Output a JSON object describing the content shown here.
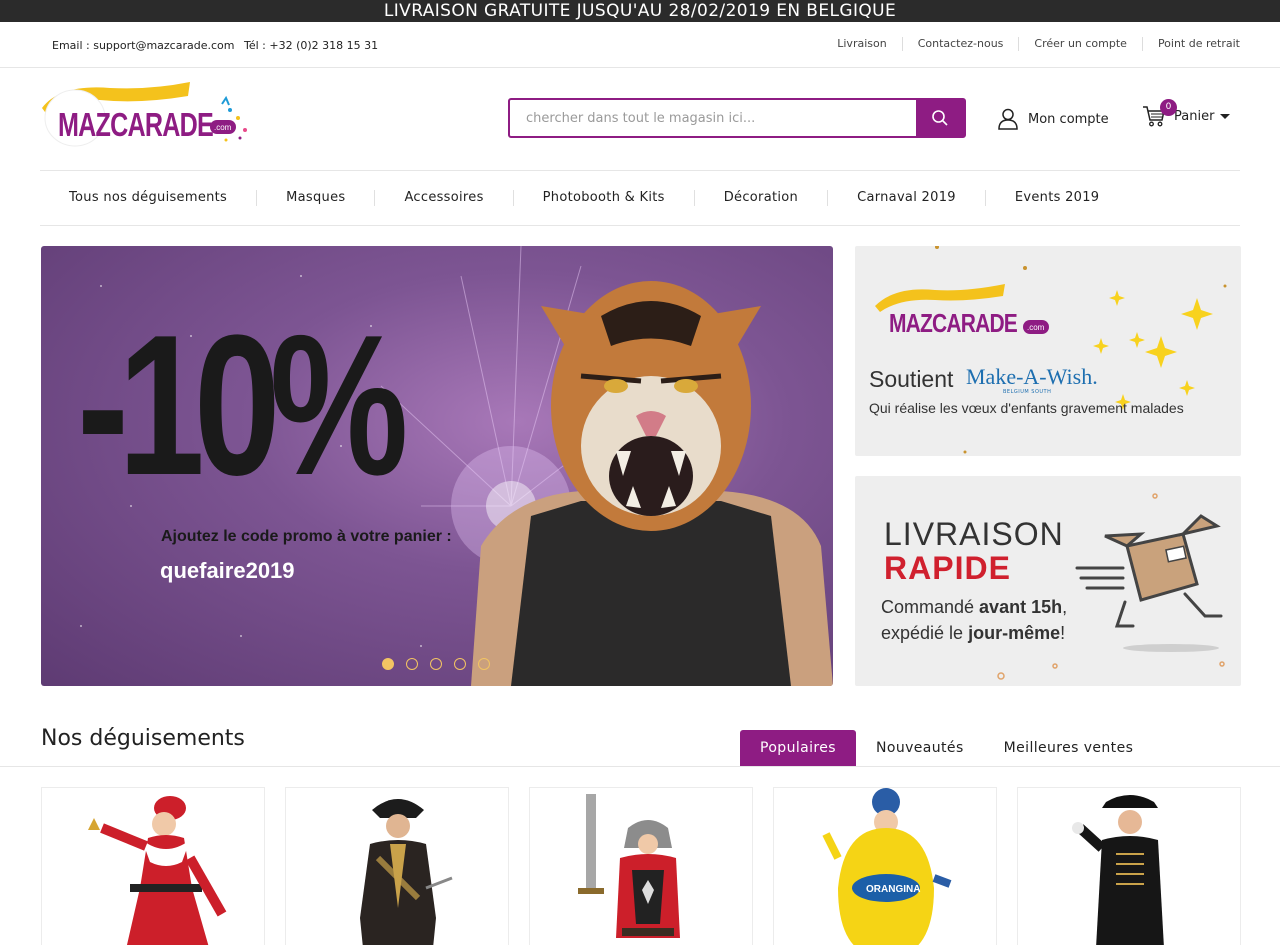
{
  "announcement": "LIVRAISON GRATUITE JUSQU'AU 28/02/2019 EN BELGIQUE",
  "contact": {
    "email": "Email : support@mazcarade.com",
    "phone": "Tél : +32 (0)2 318 15 31"
  },
  "toplinks": [
    "Livraison",
    "Contactez-nous",
    "Créer un compte",
    "Point de retrait"
  ],
  "logo_text": "MAZCARADE",
  "logo_suffix": ".com",
  "search": {
    "placeholder": "chercher dans tout le magasin ici..."
  },
  "account_label": "Mon compte",
  "cart": {
    "label": "Panier",
    "count": "0"
  },
  "nav": [
    "Tous nos déguisements",
    "Masques",
    "Accessoires",
    "Photobooth & Kits",
    "Décoration",
    "Carnaval 2019",
    "Events 2019"
  ],
  "hero": {
    "discount": "-10%",
    "subtitle": "Ajoutez le code promo à votre panier :",
    "code": "quefaire2019",
    "slides": 5,
    "active_slide": 1
  },
  "banner_charity": {
    "soutient": "Soutient",
    "partner": "Make-A-Wish.",
    "partner_sub": "BELGIUM SOUTH",
    "tagline": "Qui réalise les vœux d'enfants gravement malades"
  },
  "banner_delivery": {
    "line1": "LIVRAISON",
    "line2": "RAPIDE",
    "line3_pre": "Commandé ",
    "line3_bold": "avant 15h",
    "line3_post": ",",
    "line4_pre": "expédié le ",
    "line4_bold": "jour-même",
    "line4_post": "!"
  },
  "section_title": "Nos déguisements",
  "tabs": [
    "Populaires",
    "Nouveautés",
    "Meilleures ventes"
  ],
  "active_tab": 0,
  "products": [
    {
      "name": "mere-noel-costume"
    },
    {
      "name": "pirate-costume"
    },
    {
      "name": "knight-costume"
    },
    {
      "name": "orangina-costume"
    },
    {
      "name": "pop-star-costume"
    }
  ],
  "colors": {
    "brand": "#8e1c83",
    "announce_bg": "#2b2b2b",
    "accent_red": "#d0202e",
    "dot": "#f2c463"
  }
}
